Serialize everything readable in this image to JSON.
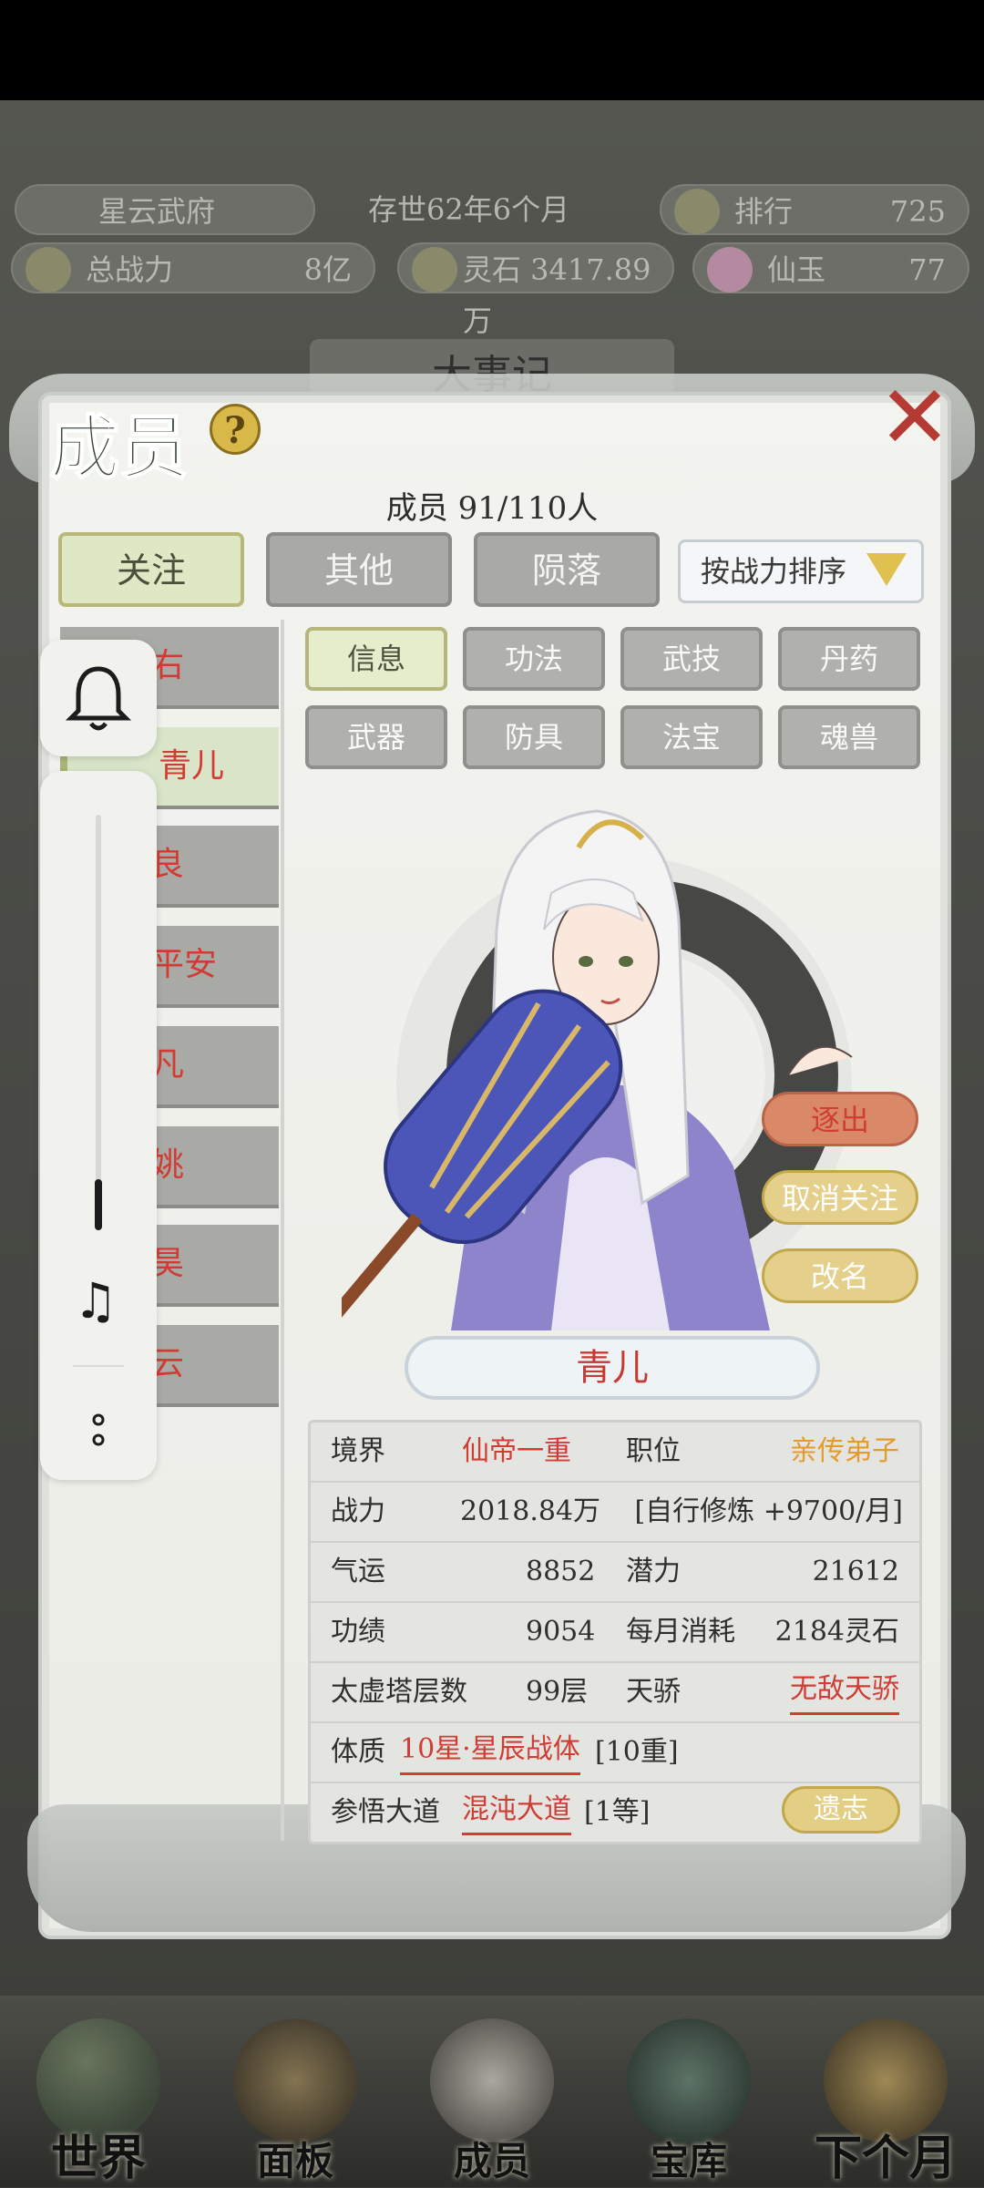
{
  "hud": {
    "sect_name": "星云武府",
    "existence": "存世62年6个月",
    "rank_label": "排行",
    "rank_value": "725",
    "power_label": "总战力",
    "power_value": "8亿",
    "spirit_stone": "灵石 3417.89万",
    "jade_label": "仙玉",
    "jade_value": "77",
    "banner_bg": "大事记"
  },
  "panel": {
    "title": "成员",
    "help": "?",
    "member_count": "成员 91/110人",
    "tabs": [
      {
        "label": "关注",
        "active": true
      },
      {
        "label": "其他",
        "active": false
      },
      {
        "label": "陨落",
        "active": false
      }
    ],
    "sort_label": "按战力排序"
  },
  "member_list": [
    {
      "name": "右",
      "selected": false
    },
    {
      "name": "青儿",
      "selected": true
    },
    {
      "name": "良",
      "selected": false
    },
    {
      "name": "平安",
      "selected": false
    },
    {
      "name": "凡",
      "selected": false
    },
    {
      "name": "姚",
      "selected": false
    },
    {
      "name": "昊",
      "selected": false
    },
    {
      "name": "云",
      "selected": false
    }
  ],
  "sub_tabs": [
    {
      "label": "信息",
      "active": true
    },
    {
      "label": "功法",
      "active": false
    },
    {
      "label": "武技",
      "active": false
    },
    {
      "label": "丹药",
      "active": false
    },
    {
      "label": "武器",
      "active": false
    },
    {
      "label": "防具",
      "active": false
    },
    {
      "label": "法宝",
      "active": false
    },
    {
      "label": "魂兽",
      "active": false
    }
  ],
  "actions": {
    "expel": "逐出",
    "unfollow": "取消关注",
    "rename": "改名",
    "remains": "遗志"
  },
  "character": {
    "name": "青儿",
    "realm_label": "境界",
    "realm_value": "仙帝一重",
    "position_label": "职位",
    "position_value": "亲传弟子",
    "power_label": "战力",
    "power_value": "2018.84万",
    "self_train": "[自行修炼 +9700/月]",
    "luck_label": "气运",
    "luck_value": "8852",
    "potential_label": "潜力",
    "potential_value": "21612",
    "merit_label": "功绩",
    "merit_value": "9054",
    "monthly_label": "每月消耗",
    "monthly_value": "2184灵石",
    "tower_label": "太虚塔层数",
    "tower_value": "99层",
    "talent_label": "天骄",
    "talent_value": "无敌天骄",
    "physique_label": "体质",
    "physique_value": "10星·星辰战体",
    "physique_level": "[10重]",
    "dao_label": "参悟大道",
    "dao_value": "混沌大道",
    "dao_level": "[1等]"
  },
  "bottom_nav": [
    {
      "label": "世界"
    },
    {
      "label": "面板"
    },
    {
      "label": "成员"
    },
    {
      "label": "宝库"
    },
    {
      "label": "下个月"
    }
  ],
  "colors": {
    "accent_red": "#cf3d35",
    "accent_orange": "#e39b2c",
    "tab_active": "#dfe8c4",
    "tab_inactive": "#a9aaa5"
  }
}
